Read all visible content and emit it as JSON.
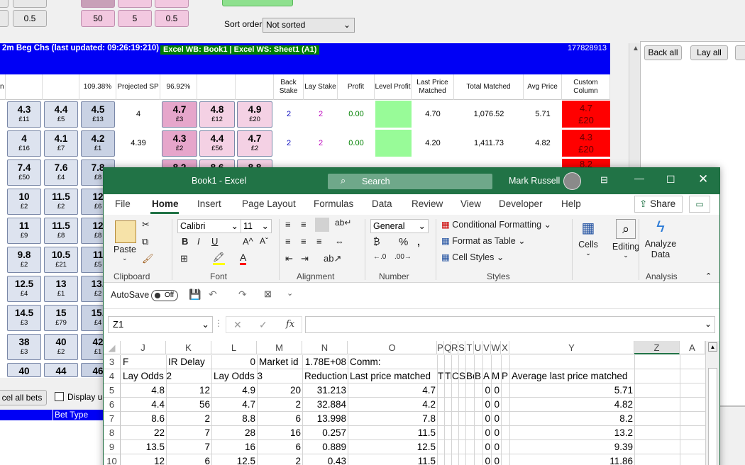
{
  "top_controls": {
    "row_a": [
      "0.5"
    ],
    "row_b": [
      "50",
      "5",
      "0.5"
    ],
    "sort_label": "Sort order",
    "sort_value": "Not sorted"
  },
  "market_bar": {
    "title": "2m Beg Chs (last updated: 09:26:19:210)",
    "badge": "Excel WB: Book1 | Excel WS: Sheet1 (A1)",
    "id": "177828913"
  },
  "right_panel": {
    "back_all": "Back all",
    "lay_all": "Lay all"
  },
  "grid_header": {
    "back_pct": "109.38%",
    "projected_sp": "Projected SP",
    "lay_pct": "96.92%",
    "back_stake": "Back Stake",
    "lay_stake": "Lay Stake",
    "profit": "Profit",
    "level_profit": "Level Profit",
    "last_price_matched": "Last Price Matched",
    "total_matched": "Total Matched",
    "avg_price": "Avg Price",
    "custom_column": "Custom Column"
  },
  "runners": [
    {
      "back": [
        {
          "p": "4.3",
          "s": "£11"
        },
        {
          "p": "4.4",
          "s": "£5"
        },
        {
          "p": "4.5",
          "s": "£13"
        }
      ],
      "sp": "4",
      "lay": [
        {
          "p": "4.7",
          "s": "£3"
        },
        {
          "p": "4.8",
          "s": "£12"
        },
        {
          "p": "4.9",
          "s": "£20"
        }
      ],
      "back_stake": "2",
      "lay_stake": "2",
      "profit": "0.00",
      "lpm": "4.70",
      "total": "1,076.52",
      "avg": "5.71",
      "custom_p": "4.7",
      "custom_s": "£20"
    },
    {
      "back": [
        {
          "p": "4",
          "s": "£16"
        },
        {
          "p": "4.1",
          "s": "£7"
        },
        {
          "p": "4.2",
          "s": "£1"
        }
      ],
      "sp": "4.39",
      "lay": [
        {
          "p": "4.3",
          "s": "£2"
        },
        {
          "p": "4.4",
          "s": "£56"
        },
        {
          "p": "4.7",
          "s": "£2"
        }
      ],
      "back_stake": "2",
      "lay_stake": "2",
      "profit": "0.00",
      "lpm": "4.20",
      "total": "1,411.73",
      "avg": "4.82",
      "custom_p": "4.3",
      "custom_s": "£20"
    },
    {
      "back": [
        {
          "p": "7.4",
          "s": "£50"
        },
        {
          "p": "7.6",
          "s": "£4"
        },
        {
          "p": "7.8",
          "s": "£8"
        }
      ],
      "lay": [
        {
          "p": "8.2",
          "s": ""
        },
        {
          "p": "8.6",
          "s": ""
        },
        {
          "p": "8.8",
          "s": ""
        }
      ],
      "custom_p": "8.2"
    },
    {
      "back": [
        {
          "p": "10",
          "s": "£2"
        },
        {
          "p": "11.5",
          "s": "£2"
        },
        {
          "p": "12",
          "s": "£6"
        }
      ]
    },
    {
      "back": [
        {
          "p": "11",
          "s": "£9"
        },
        {
          "p": "11.5",
          "s": "£8"
        },
        {
          "p": "12",
          "s": "£8"
        }
      ]
    },
    {
      "back": [
        {
          "p": "9.8",
          "s": "£2"
        },
        {
          "p": "10.5",
          "s": "£21"
        },
        {
          "p": "11",
          "s": "£5"
        }
      ]
    },
    {
      "back": [
        {
          "p": "12.5",
          "s": "£4"
        },
        {
          "p": "13",
          "s": "£1"
        },
        {
          "p": "13.",
          "s": "£2"
        }
      ]
    },
    {
      "back": [
        {
          "p": "14.5",
          "s": "£3"
        },
        {
          "p": "15",
          "s": "£79"
        },
        {
          "p": "15.",
          "s": "£4"
        }
      ]
    },
    {
      "back": [
        {
          "p": "38",
          "s": "£3"
        },
        {
          "p": "40",
          "s": "£2"
        },
        {
          "p": "42",
          "s": "£1"
        }
      ]
    },
    {
      "back": [
        {
          "p": "40",
          "s": ""
        },
        {
          "p": "44",
          "s": ""
        },
        {
          "p": "46",
          "s": ""
        }
      ]
    }
  ],
  "bottom": {
    "cancel_all": "cel all bets",
    "display_un": "Display un",
    "bet_type": "Bet Type"
  },
  "excel": {
    "title": "Book1  -  Excel",
    "search": "Search",
    "user": "Mark Russell",
    "menu": [
      "File",
      "Home",
      "Insert",
      "Page Layout",
      "Formulas",
      "Data",
      "Review",
      "View",
      "Developer",
      "Help"
    ],
    "share": "Share",
    "ribbon": {
      "paste": "Paste",
      "font_name": "Calibri",
      "font_size": "11",
      "number_format": "General",
      "conditional_formatting": "Conditional Formatting",
      "format_as_table": "Format as Table",
      "cell_styles": "Cell Styles",
      "cells": "Cells",
      "editing": "Editing",
      "analyze_data": "Analyze Data",
      "groups": [
        "Clipboard",
        "Font",
        "Alignment",
        "Number",
        "Styles",
        "Analysis"
      ]
    },
    "autosave": "AutoSave",
    "autosave_state": "Off",
    "name_box": "Z1",
    "fx": "fx",
    "columns": [
      "J",
      "K",
      "L",
      "M",
      "N",
      "O",
      "P",
      "Q",
      "R",
      "S",
      "T",
      "U",
      "V",
      "W",
      "X",
      "Y",
      "Z",
      "A"
    ],
    "row_numbers": [
      "3",
      "4",
      "5",
      "6",
      "7",
      "8",
      "9",
      "10"
    ],
    "rows": [
      {
        "J": "F",
        "K": "IR Delay",
        "L": "0",
        "M": "Market id",
        "N": "1.78E+08",
        "O": "Comm:",
        "Y": ""
      },
      {
        "J": "Lay Odds 2",
        "K": "",
        "L": "Lay Odds 3",
        "M": "",
        "N": "Reduction",
        "O": "Last price matched",
        "P": "T",
        "Q": "Tr",
        "R": "C",
        "S": "S",
        "T": "Be",
        "U": "B",
        "V": "A",
        "W": "M",
        "X": "P",
        "Y": "Average last price matched"
      },
      {
        "J": "4.8",
        "K": "12",
        "L": "4.9",
        "M": "20",
        "N": "31.213",
        "O": "4.7",
        "V": "0",
        "W": "0",
        "Y": "5.71"
      },
      {
        "J": "4.4",
        "K": "56",
        "L": "4.7",
        "M": "2",
        "N": "32.884",
        "O": "4.2",
        "V": "0",
        "W": "0",
        "Y": "4.82"
      },
      {
        "J": "8.6",
        "K": "2",
        "L": "8.8",
        "M": "6",
        "N": "13.998",
        "O": "7.8",
        "V": "0",
        "W": "0",
        "Y": "8.2"
      },
      {
        "J": "22",
        "K": "7",
        "L": "28",
        "M": "16",
        "N": "0.257",
        "O": "11.5",
        "V": "0",
        "W": "0",
        "Y": "13.2"
      },
      {
        "J": "13.5",
        "K": "7",
        "L": "16",
        "M": "6",
        "N": "0.889",
        "O": "12.5",
        "V": "0",
        "W": "0",
        "Y": "9.39"
      },
      {
        "J": "12",
        "K": "6",
        "L": "12.5",
        "M": "2",
        "N": "0.43",
        "O": "11.5",
        "V": "0",
        "W": "0",
        "Y": "11.86"
      }
    ]
  },
  "colors": {
    "excel_green": "#217346",
    "market_blue": "#0000f5",
    "custom_red": "#ff0000",
    "level_profit_green": "#98fb98"
  }
}
